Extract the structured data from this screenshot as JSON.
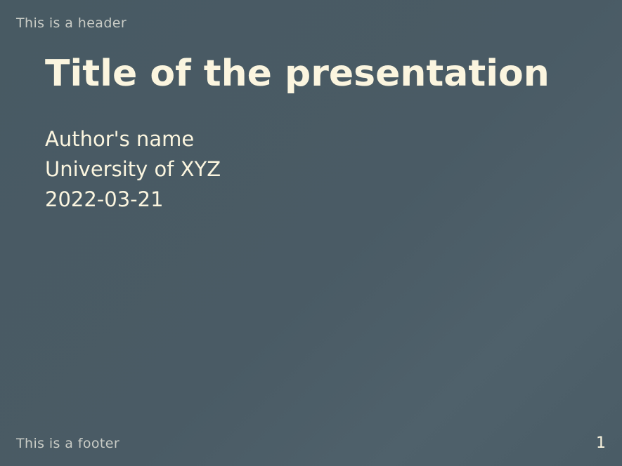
{
  "header": {
    "text": "This is a header"
  },
  "title": "Title of the presentation",
  "meta": {
    "author": "Author's name",
    "institution": "University of XYZ",
    "date": "2022-03-21"
  },
  "footer": {
    "text": "This is a footer",
    "page_number": "1"
  },
  "colors": {
    "background": "#4a5b65",
    "title_text": "#fbf5df",
    "header_footer_text": "#c9ccc6"
  }
}
